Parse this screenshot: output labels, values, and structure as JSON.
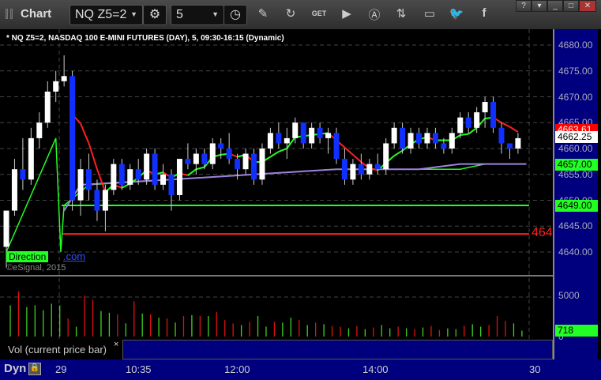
{
  "window": {
    "title": "Chart",
    "symbol": "NQ Z5=2",
    "interval": "5",
    "help": "?",
    "minimize": "_",
    "maximize": "□",
    "close": "✕"
  },
  "toolbar": [
    "pencil-icon",
    "refresh-icon",
    "get-icon",
    "play-icon",
    "alert-icon",
    "link-icon",
    "comment-icon",
    "twitter-icon",
    "facebook-icon"
  ],
  "chart": {
    "title": "* NQ Z5=2, NASDAQ 100 E-MINI FUTURES (DAY), 5, 09:30-16:15 (Dynamic)",
    "direction_label": "Direction",
    "watermark": "©eSignal, 2015",
    "link_fragment": ".com",
    "red_level_text": "464"
  },
  "price_axis": {
    "labels": [
      "4680.00",
      "4675.00",
      "4670.00",
      "4665.00",
      "4660.00",
      "4655.00",
      "4650.00",
      "4645.00",
      "4640.00"
    ],
    "tags": [
      {
        "text": "4663.61",
        "color": "#ff0000",
        "value": 4663.61,
        "fg": "#fff"
      },
      {
        "text": "4662.25",
        "color": "#ffffff",
        "value": 4662.25,
        "fg": "#000"
      },
      {
        "text": "4657.00",
        "color": "#22ff22",
        "value": 4657,
        "fg": "#000"
      },
      {
        "text": "4649.00",
        "color": "#22ff22",
        "value": 4649,
        "fg": "#000"
      }
    ]
  },
  "volume": {
    "title": "Vol (current price bar)",
    "close": "×",
    "axis_label": "5000",
    "zero_label": "0",
    "tag": "718"
  },
  "time_axis": {
    "mode": "Dyn",
    "labels": [
      "29",
      "10:35",
      "12:00",
      "14:00",
      "30"
    ]
  },
  "chart_data": {
    "type": "candlestick",
    "ylim": [
      4637,
      4682
    ],
    "ohlc": [
      [
        4641,
        4648,
        4637,
        4648
      ],
      [
        4648,
        4658,
        4647,
        4656
      ],
      [
        4656,
        4662,
        4652,
        4654
      ],
      [
        4654,
        4664,
        4653,
        4662
      ],
      [
        4662,
        4667,
        4660,
        4665
      ],
      [
        4665,
        4673,
        4664,
        4671
      ],
      [
        4671,
        4675,
        4669,
        4673
      ],
      [
        4673,
        4678,
        4672,
        4674
      ],
      [
        4674,
        4675,
        4648,
        4650
      ],
      [
        4650,
        4658,
        4647,
        4656
      ],
      [
        4656,
        4659,
        4650,
        4652
      ],
      [
        4652,
        4654,
        4646,
        4648
      ],
      [
        4648,
        4653,
        4644,
        4652
      ],
      [
        4652,
        4658,
        4651,
        4657
      ],
      [
        4657,
        4658,
        4652,
        4653
      ],
      [
        4653,
        4657,
        4652,
        4656
      ],
      [
        4656,
        4658,
        4653,
        4654
      ],
      [
        4654,
        4660,
        4653,
        4659
      ],
      [
        4659,
        4660,
        4652,
        4653
      ],
      [
        4653,
        4657,
        4652,
        4655
      ],
      [
        4655,
        4656,
        4648,
        4651
      ],
      [
        4651,
        4658,
        4650,
        4658
      ],
      [
        4658,
        4661,
        4656,
        4657
      ],
      [
        4657,
        4660,
        4655,
        4659
      ],
      [
        4659,
        4660,
        4656,
        4657
      ],
      [
        4657,
        4662,
        4656,
        4661
      ],
      [
        4661,
        4662,
        4658,
        4660
      ],
      [
        4660,
        4663,
        4657,
        4658
      ],
      [
        4658,
        4659,
        4654,
        4656
      ],
      [
        4656,
        4660,
        4655,
        4659
      ],
      [
        4659,
        4660,
        4653,
        4654
      ],
      [
        4654,
        4661,
        4653,
        4660
      ],
      [
        4660,
        4664,
        4659,
        4663
      ],
      [
        4663,
        4665,
        4660,
        4661
      ],
      [
        4661,
        4664,
        4658,
        4662
      ],
      [
        4662,
        4666,
        4661,
        4665
      ],
      [
        4665,
        4665,
        4660,
        4661
      ],
      [
        4661,
        4665,
        4660,
        4664
      ],
      [
        4664,
        4665,
        4661,
        4662
      ],
      [
        4662,
        4664,
        4659,
        4663
      ],
      [
        4663,
        4664,
        4657,
        4658
      ],
      [
        4658,
        4660,
        4653,
        4654
      ],
      [
        4654,
        4658,
        4653,
        4657
      ],
      [
        4657,
        4659,
        4654,
        4655
      ],
      [
        4655,
        4658,
        4654,
        4657
      ],
      [
        4657,
        4659,
        4655,
        4656
      ],
      [
        4656,
        4662,
        4655,
        4661
      ],
      [
        4661,
        4665,
        4660,
        4664
      ],
      [
        4664,
        4665,
        4659,
        4660
      ],
      [
        4660,
        4664,
        4659,
        4663
      ],
      [
        4663,
        4664,
        4660,
        4661
      ],
      [
        4661,
        4664,
        4660,
        4663
      ],
      [
        4663,
        4664,
        4660,
        4661
      ],
      [
        4661,
        4662,
        4659,
        4660
      ],
      [
        4660,
        4664,
        4659,
        4663
      ],
      [
        4663,
        4667,
        4662,
        4666
      ],
      [
        4666,
        4667,
        4663,
        4664
      ],
      [
        4664,
        4668,
        4663,
        4667
      ],
      [
        4667,
        4670,
        4664,
        4669
      ],
      [
        4669,
        4670,
        4663,
        4664
      ],
      [
        4664,
        4665,
        4659,
        4661
      ],
      [
        4661,
        4661,
        4658,
        4660
      ],
      [
        4660,
        4663,
        4659,
        4662
      ]
    ],
    "volume": [
      3800,
      5500,
      3600,
      3800,
      3200,
      4000,
      3800,
      2200,
      1200,
      5000,
      4500,
      3100,
      2900,
      2700,
      1600,
      4300,
      2800,
      2700,
      2300,
      2200,
      1700,
      2500,
      2600,
      2500,
      2500,
      3000,
      2000,
      1600,
      1400,
      1800,
      2500,
      1200,
      1800,
      1700,
      2300,
      2000,
      1400,
      1700,
      1500,
      1300,
      1200,
      1000,
      1300,
      900,
      1100,
      1400,
      1000,
      1200,
      1000,
      900,
      1100,
      1300,
      800,
      1000,
      900,
      1300,
      1500,
      1200,
      1400,
      2500,
      1900,
      1600,
      718
    ],
    "horizontal_lines": [
      {
        "value": 4649,
        "color": "#22ff22"
      },
      {
        "value": 4643.5,
        "color": "#ff2020"
      }
    ]
  }
}
